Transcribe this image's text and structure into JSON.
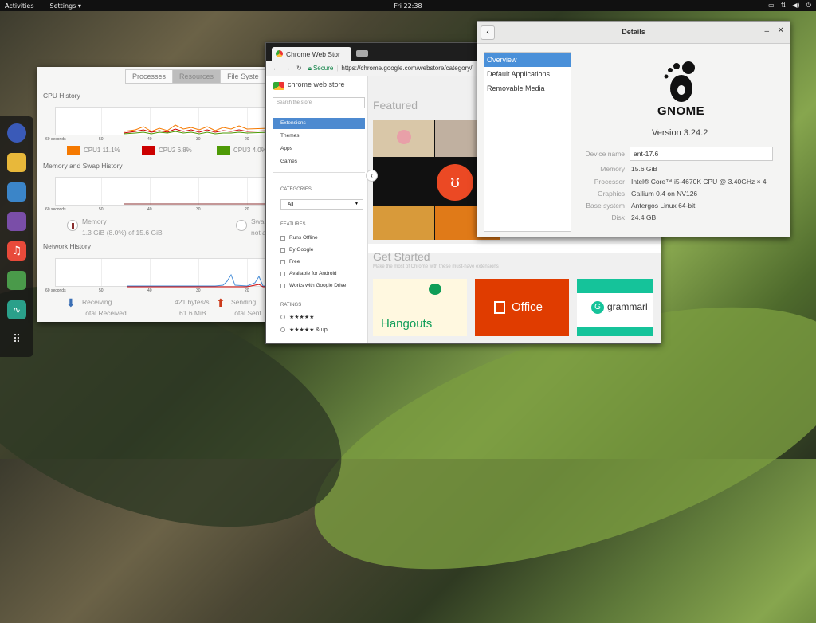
{
  "topbar": {
    "activities": "Activities",
    "settings": "Settings ▾",
    "clock": "Fri 22:38",
    "tray_icons": [
      "screen-icon",
      "network-icon",
      "volume-icon",
      "power-icon"
    ]
  },
  "dash": {
    "apps": [
      {
        "name": "app1-icon",
        "color": "#3a5ab8"
      },
      {
        "name": "files-icon",
        "color": "#e8b83a"
      },
      {
        "name": "magnifier-icon",
        "color": "#3b85c8"
      },
      {
        "name": "chat-bird-icon",
        "color": "#7a4ea8"
      },
      {
        "name": "music-icon",
        "color": "#e84a3a"
      },
      {
        "name": "settings-toggles-icon",
        "color": "#4a9a4a"
      },
      {
        "name": "system-monitor-icon",
        "color": "#2aa08a"
      },
      {
        "name": "app-grid-icon",
        "color": "#555555"
      }
    ]
  },
  "sysmon": {
    "tabs": [
      "Processes",
      "Resources",
      "File Syste"
    ],
    "cpu_title": "CPU History",
    "mem_title": "Memory and Swap History",
    "net_title": "Network History",
    "axis": [
      "60 seconds",
      "50",
      "40",
      "30",
      "20"
    ],
    "cpu_legend": [
      {
        "label": "CPU1 11.1%",
        "color": "#f57900"
      },
      {
        "label": "CPU2 6.8%",
        "color": "#cc0000"
      },
      {
        "label": "CPU3 4.0%",
        "color": "#4e9a06"
      }
    ],
    "memory_label": "Memory",
    "memory_value": "1.3 GiB (8.0%) of 15.6 GiB",
    "swap_label": "Swa",
    "swap_value": "not a",
    "receiving_label": "Receiving",
    "receiving_rate": "421 bytes/s",
    "total_received_label": "Total Received",
    "total_received_value": "61.6 MiB",
    "sending_label": "Sending",
    "total_sent_label": "Total Sent"
  },
  "chrome": {
    "tab_title": "Chrome Web Stor",
    "secure": "Secure",
    "url": "https://chrome.google.com/webstore/category/",
    "store_title": "chrome web store",
    "search_placeholder": "Search the store",
    "categories": [
      "Extensions",
      "Themes",
      "Apps",
      "Games"
    ],
    "categories_head": "CATEGORIES",
    "all_select": "All",
    "features_head": "FEATURES",
    "features": [
      "Runs Offline",
      "By Google",
      "Free",
      "Available for Android",
      "Works with Google Drive"
    ],
    "ratings_head": "RATINGS",
    "rating_rows": [
      "★★★★★",
      "★★★★★ & up"
    ],
    "featured": "Featured",
    "get_started": "Get Started",
    "get_started_sub": "Make the most of Chrome with these must-have extensions",
    "hangouts": "Hangouts",
    "office": "Office",
    "grammarly": "grammarl"
  },
  "details": {
    "title": "Details",
    "sidebar": [
      "Overview",
      "Default Applications",
      "Removable Media"
    ],
    "gnome_word": "GNOME",
    "version": "Version 3.24.2",
    "device_name_label": "Device name",
    "device_name_value": "ant-17.6",
    "rows": [
      {
        "label": "Memory",
        "value": "15.6 GiB"
      },
      {
        "label": "Processor",
        "value": "Intel® Core™ i5-4670K CPU @ 3.40GHz × 4"
      },
      {
        "label": "Graphics",
        "value": "Gallium 0.4 on NV126"
      },
      {
        "label": "Base system",
        "value": "Antergos Linux 64-bit"
      },
      {
        "label": "Disk",
        "value": "24.4 GB"
      }
    ]
  }
}
